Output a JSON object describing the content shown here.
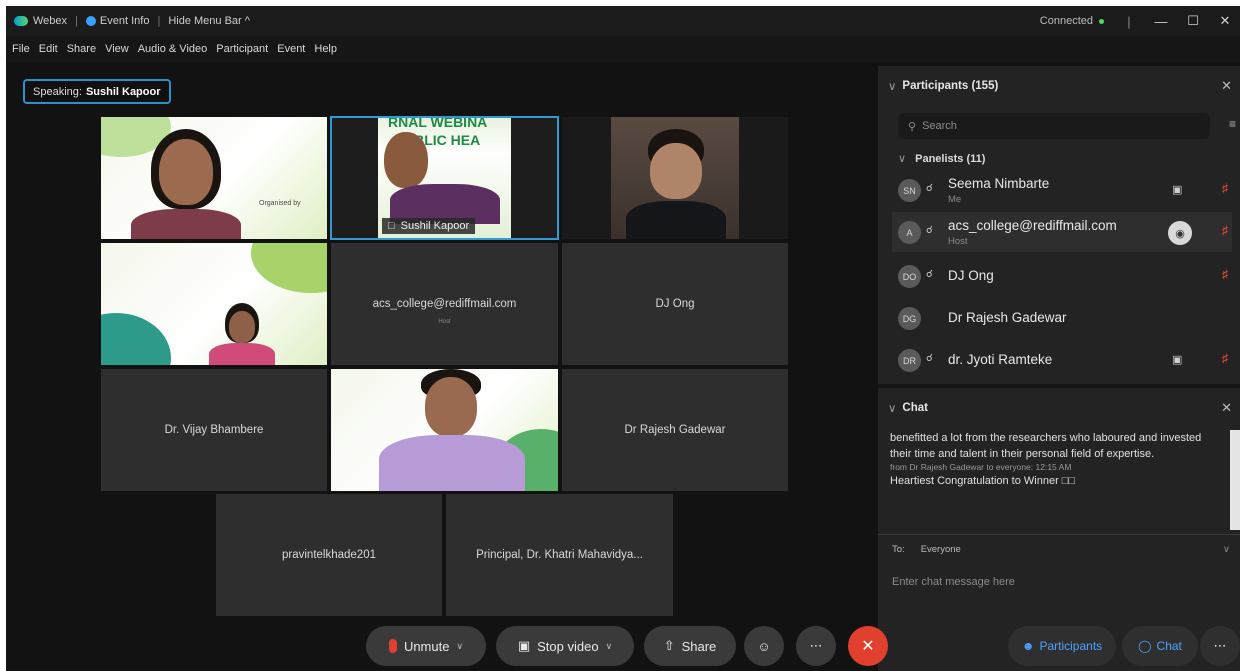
{
  "titlebar": {
    "app_name": "Webex",
    "event_info": "Event Info",
    "hide_menu": "Hide Menu Bar ^",
    "status": "Connected",
    "min": "—",
    "max": "☐",
    "close": "✕"
  },
  "menu": {
    "file": "File",
    "edit": "Edit",
    "share": "Share",
    "view": "View",
    "audio_video": "Audio & Video",
    "participant": "Participant",
    "event": "Event",
    "help": "Help"
  },
  "speaking": {
    "prefix": "Speaking:",
    "name": "Sushil Kapoor"
  },
  "tiles": {
    "t1_slide": "Organised by",
    "t2_banner": "RNAL WEBINA",
    "t2_banner2": "UBLIC HEA",
    "t2_label": "Sushil Kapoor",
    "t5_name": "acs_college@rediffmail.com",
    "t5_sub": "Host",
    "t6_name": "DJ Ong",
    "t7_name": "Dr. Vijay Bhambere",
    "t9_name": "Dr Rajesh Gadewar",
    "t10_name": "pravintelkhade201",
    "t11_name": "Principal, Dr. Khatri Mahavidya..."
  },
  "panel": {
    "participants_title": "Participants (155)",
    "search_placeholder": "Search",
    "panelists_title": "Panelists (11)",
    "panelists": [
      {
        "initials": "SN",
        "name": "Seema Nimbarte",
        "role": "Me"
      },
      {
        "initials": "A",
        "name": "acs_college@rediffmail.com",
        "role": "Host"
      },
      {
        "initials": "DO",
        "name": "DJ Ong",
        "role": ""
      },
      {
        "initials": "DG",
        "name": "Dr Rajesh Gadewar",
        "role": ""
      },
      {
        "initials": "DR",
        "name": "dr. Jyoti Ramteke",
        "role": ""
      }
    ],
    "chat_title": "Chat",
    "chat_msg1": "benefitted a lot from the researchers who laboured and invested their time and talent in their personal field of expertise.",
    "chat_meta": "from Dr Rajesh Gadewar to everyone:   12:15 AM",
    "chat_msg2": "Heartiest Congratulation to Winner □□",
    "to_label": "To:",
    "to_value": "Everyone",
    "chat_placeholder": "Enter chat message here"
  },
  "controls": {
    "unmute": "Unmute",
    "stop_video": "Stop video",
    "share": "Share",
    "participants": "Participants",
    "chat": "Chat"
  },
  "colors": {
    "accent": "#2f9bd6",
    "leave": "#e2402e",
    "panel_bg": "#232323",
    "tile_bg": "#2e2e2e"
  }
}
